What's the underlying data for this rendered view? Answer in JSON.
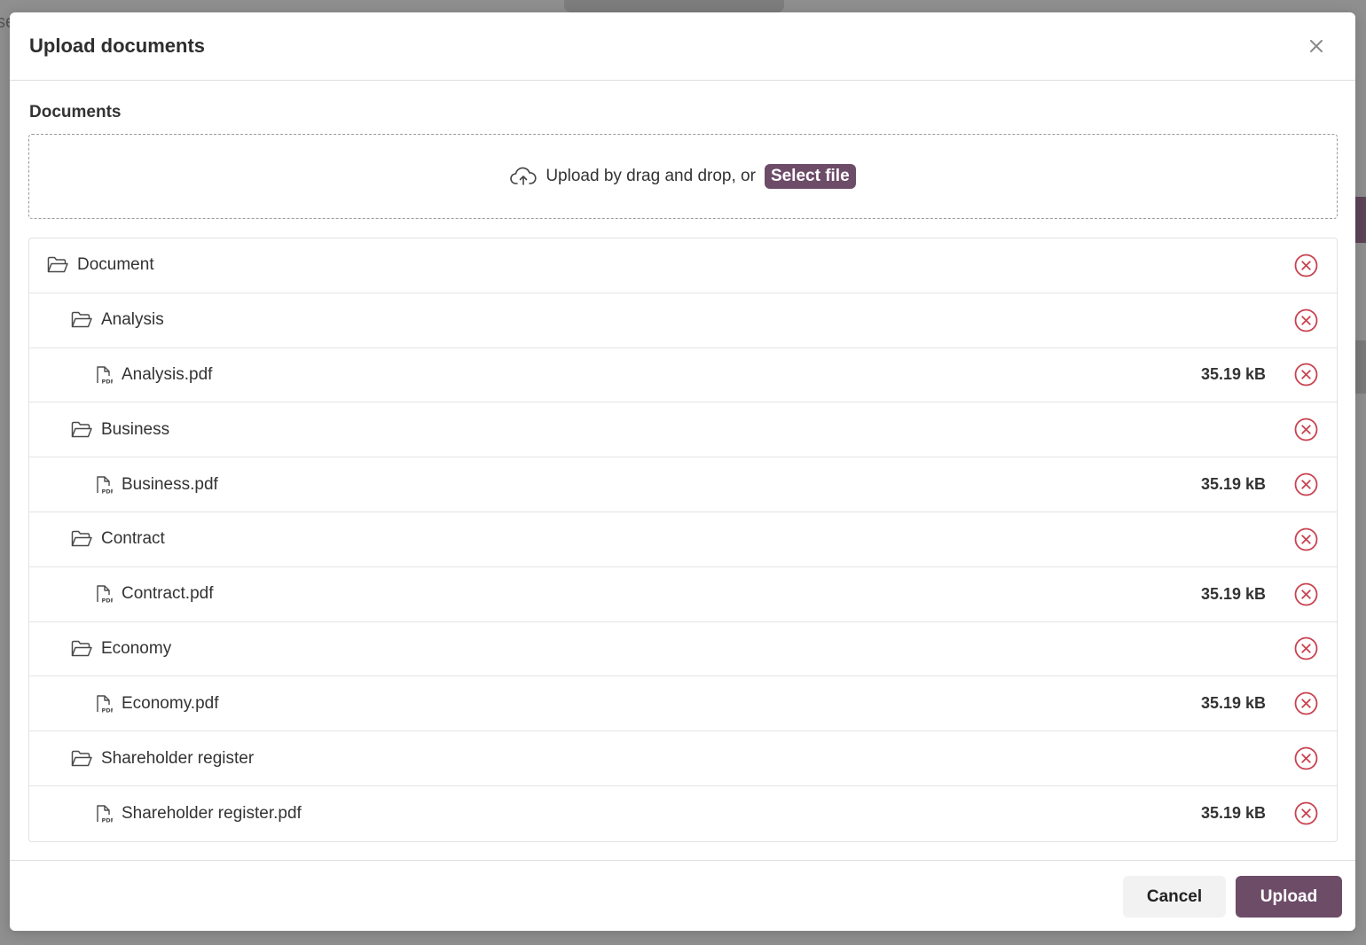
{
  "background": {
    "partial_text": "se"
  },
  "colors": {
    "accent": "#6d4c68",
    "remove": "#c8424f",
    "border": "#e2e2e2"
  },
  "modal": {
    "title": "Upload documents",
    "close_icon": "close-icon",
    "section_label": "Documents",
    "dropzone": {
      "icon": "cloud-upload-icon",
      "text": "Upload by drag and drop, or",
      "select_label": "Select file"
    },
    "tree": [
      {
        "type": "folder",
        "level": 0,
        "name": "Document",
        "icon": "folder-open-icon"
      },
      {
        "type": "folder",
        "level": 1,
        "name": "Analysis",
        "icon": "folder-open-icon"
      },
      {
        "type": "file",
        "level": 2,
        "name": "Analysis.pdf",
        "size": "35.19 kB",
        "icon": "pdf-file-icon"
      },
      {
        "type": "folder",
        "level": 1,
        "name": "Business",
        "icon": "folder-open-icon"
      },
      {
        "type": "file",
        "level": 2,
        "name": "Business.pdf",
        "size": "35.19 kB",
        "icon": "pdf-file-icon"
      },
      {
        "type": "folder",
        "level": 1,
        "name": "Contract",
        "icon": "folder-open-icon"
      },
      {
        "type": "file",
        "level": 2,
        "name": "Contract.pdf",
        "size": "35.19 kB",
        "icon": "pdf-file-icon"
      },
      {
        "type": "folder",
        "level": 1,
        "name": "Economy",
        "icon": "folder-open-icon"
      },
      {
        "type": "file",
        "level": 2,
        "name": "Economy.pdf",
        "size": "35.19 kB",
        "icon": "pdf-file-icon"
      },
      {
        "type": "folder",
        "level": 1,
        "name": "Shareholder register",
        "icon": "folder-open-icon"
      },
      {
        "type": "file",
        "level": 2,
        "name": "Shareholder register.pdf",
        "size": "35.19 kB",
        "icon": "pdf-file-icon"
      }
    ],
    "footer": {
      "cancel_label": "Cancel",
      "upload_label": "Upload"
    }
  }
}
